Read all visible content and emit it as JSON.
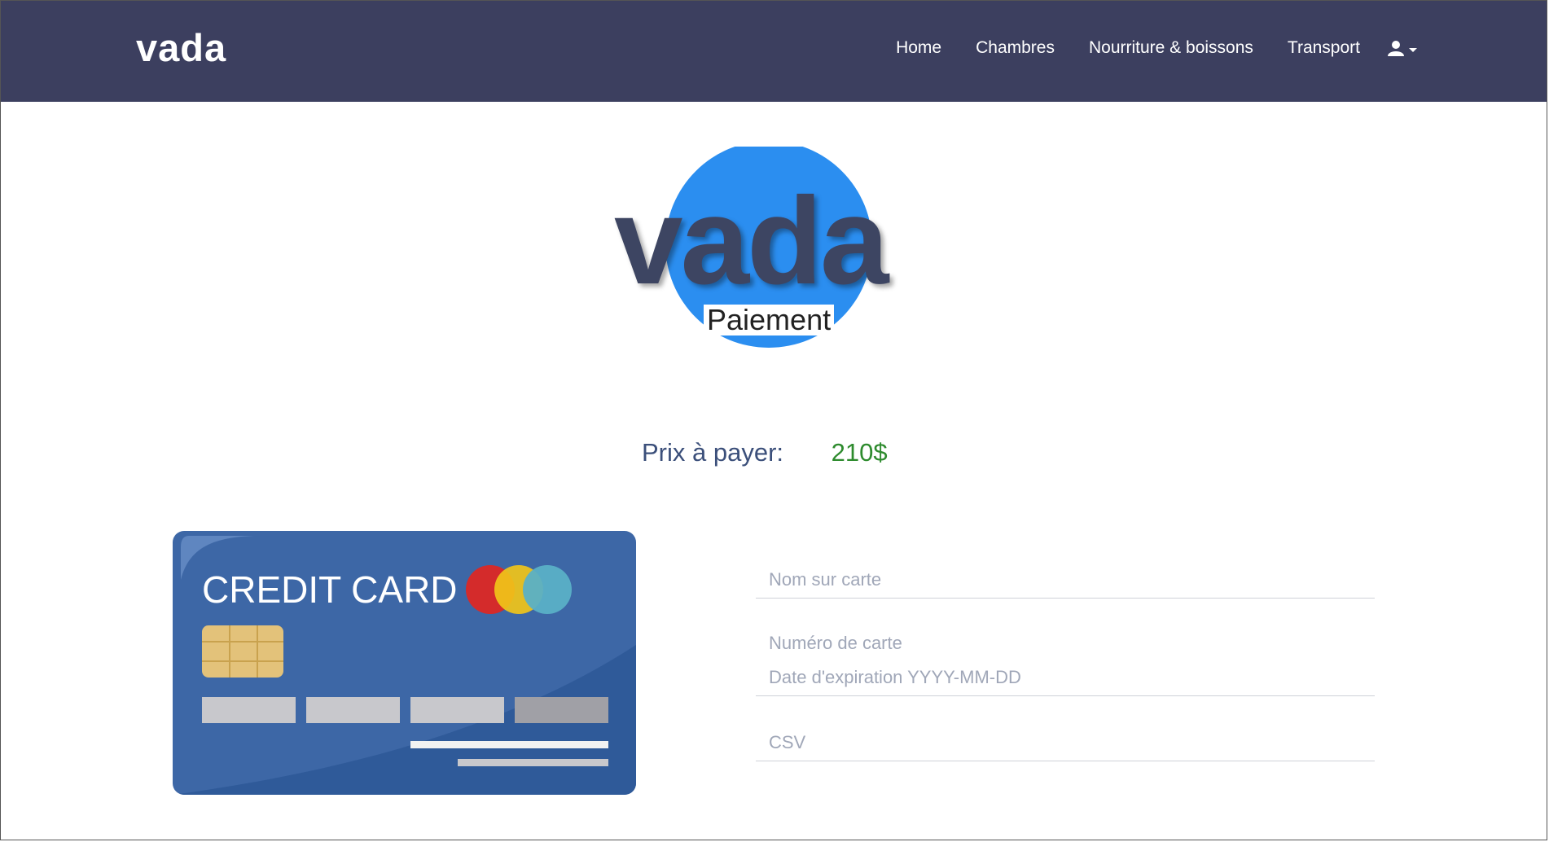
{
  "navbar": {
    "brand": "vada",
    "links": [
      "Home",
      "Chambres",
      "Nourriture & boissons",
      "Transport"
    ],
    "user_icon": "user-icon"
  },
  "logo": {
    "word": "vada",
    "subtitle": "Paiement"
  },
  "price": {
    "label": "Prix à payer:",
    "value": "210$"
  },
  "card_illustration": {
    "title": "CREDIT CARD",
    "colors": {
      "card": "#3d67a6",
      "chip": "#e3c27a",
      "red": "#d42b2b",
      "yellow": "#f0c419",
      "teal": "#5ab0c6"
    }
  },
  "form": {
    "name_placeholder": "Nom sur carte",
    "number_placeholder": "Numéro de carte",
    "expiry_placeholder": "Date d'expiration YYYY-MM-DD",
    "csv_placeholder": "CSV"
  },
  "colors": {
    "navbar": "#3c3f5f",
    "logo_circle": "#2b8ef0",
    "price_value": "#2e8b2e"
  }
}
